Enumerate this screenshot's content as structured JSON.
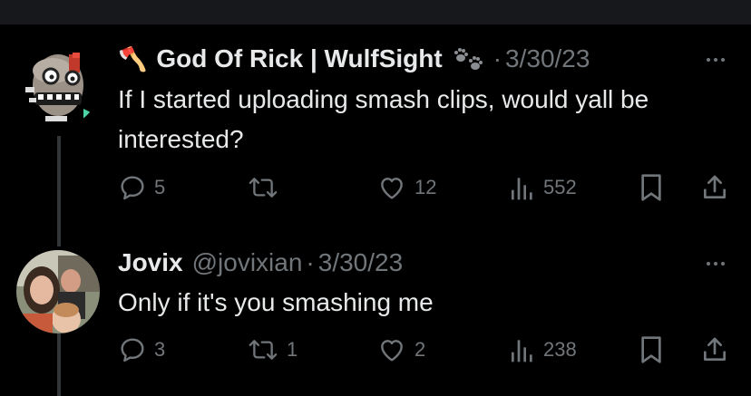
{
  "tweets": [
    {
      "emoji": "🪓",
      "author": "God Of Rick | WulfSight",
      "author_suffix_icon": "paw-prints-icon",
      "separator": "·",
      "date": "3/30/23",
      "text": "If I started uploading smash clips, would yall be interested?",
      "actions": {
        "reply_count": "5",
        "retweet_count": "",
        "like_count": "12",
        "view_count": "552"
      }
    },
    {
      "author": "Jovix",
      "handle": "@jovixian",
      "separator": "·",
      "date": "3/30/23",
      "text": "Only if it's you smashing me",
      "actions": {
        "reply_count": "3",
        "retweet_count": "1",
        "like_count": "2",
        "view_count": "238"
      }
    }
  ],
  "colors": {
    "background": "#000000",
    "text": "#e7e9ea",
    "muted": "#71767b",
    "thread_line": "#333639",
    "topbar": "#16181c"
  }
}
